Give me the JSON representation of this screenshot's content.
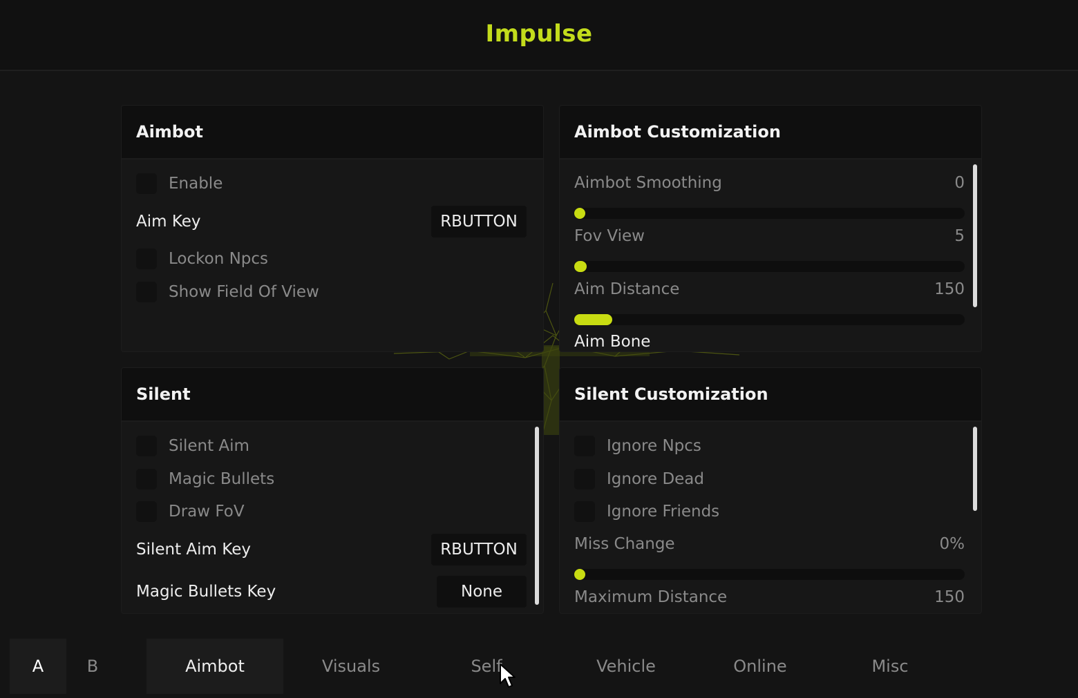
{
  "app": {
    "title": "Impulse",
    "accent_color": "#c3dc1c"
  },
  "aimbot_panel": {
    "title": "Aimbot",
    "enable_label": "Enable",
    "aim_key_label": "Aim Key",
    "aim_key_value": "RBUTTON",
    "lockon_npcs_label": "Lockon Npcs",
    "show_fov_label": "Show Field Of View"
  },
  "aimbot_customization_panel": {
    "title": "Aimbot Customization",
    "sliders": [
      {
        "label": "Aimbot Smoothing",
        "value": "0",
        "fill_fraction": 0.0
      },
      {
        "label": "Fov View",
        "value": "5",
        "fill_fraction": 0.05
      },
      {
        "label": "Aim Distance",
        "value": "150",
        "fill_fraction": 0.15
      }
    ],
    "aim_bone_label": "Aim Bone"
  },
  "silent_panel": {
    "title": "Silent",
    "silent_aim_label": "Silent Aim",
    "magic_bullets_label": "Magic Bullets",
    "draw_fov_label": "Draw FoV",
    "silent_aim_key_label": "Silent Aim Key",
    "silent_aim_key_value": "RBUTTON",
    "magic_bullets_key_label": "Magic Bullets Key",
    "magic_bullets_key_value": "None"
  },
  "silent_customization_panel": {
    "title": "Silent Customization",
    "ignore_npcs_label": "Ignore Npcs",
    "ignore_dead_label": "Ignore Dead",
    "ignore_friends_label": "Ignore Friends",
    "miss_change_label": "Miss Change",
    "miss_change_value": "0%",
    "miss_change_fill_fraction": 0.0,
    "max_distance_label": "Maximum Distance",
    "max_distance_value": "150"
  },
  "tabbar": {
    "sub_tabs": [
      "A",
      "B"
    ],
    "tabs": [
      "Aimbot",
      "Visuals",
      "Self",
      "Vehicle",
      "Online",
      "Misc"
    ],
    "active_tab": "Aimbot",
    "active_sub_tab": "A"
  }
}
